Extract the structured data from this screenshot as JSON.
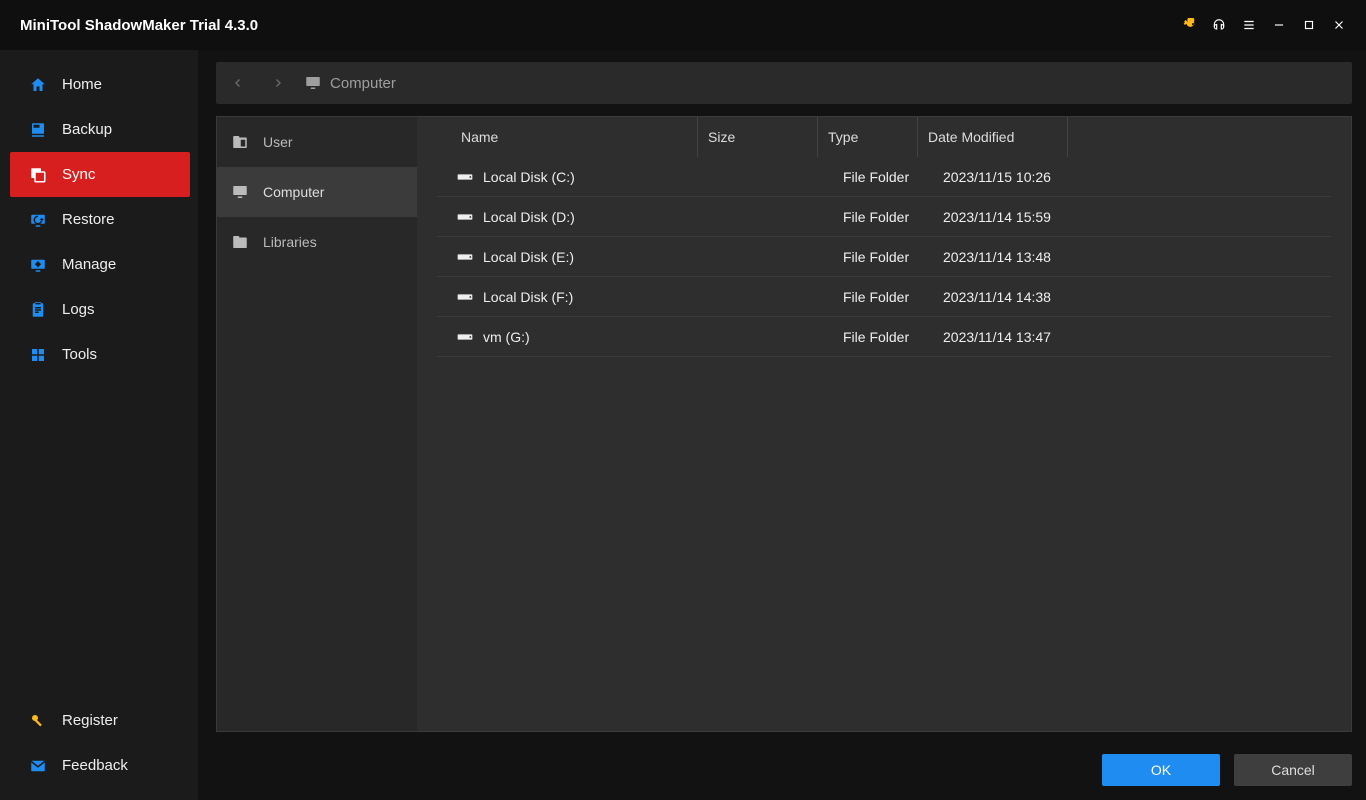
{
  "titlebar": {
    "title": "MiniTool ShadowMaker Trial 4.3.0"
  },
  "sidebar": {
    "items": [
      {
        "name": "home",
        "label": "Home"
      },
      {
        "name": "backup",
        "label": "Backup"
      },
      {
        "name": "sync",
        "label": "Sync"
      },
      {
        "name": "restore",
        "label": "Restore"
      },
      {
        "name": "manage",
        "label": "Manage"
      },
      {
        "name": "logs",
        "label": "Logs"
      },
      {
        "name": "tools",
        "label": "Tools"
      }
    ],
    "bottom": [
      {
        "name": "register",
        "label": "Register"
      },
      {
        "name": "feedback",
        "label": "Feedback"
      }
    ]
  },
  "breadcrumb": {
    "current": "Computer"
  },
  "tree": [
    {
      "name": "user",
      "label": "User"
    },
    {
      "name": "computer",
      "label": "Computer"
    },
    {
      "name": "libraries",
      "label": "Libraries"
    }
  ],
  "columns": {
    "name": "Name",
    "size": "Size",
    "type": "Type",
    "date": "Date Modified"
  },
  "rows": [
    {
      "name": "Local Disk (C:)",
      "size": "",
      "type": "File Folder",
      "date": "2023/11/15 10:26"
    },
    {
      "name": "Local Disk (D:)",
      "size": "",
      "type": "File Folder",
      "date": "2023/11/14 15:59"
    },
    {
      "name": "Local Disk (E:)",
      "size": "",
      "type": "File Folder",
      "date": "2023/11/14 13:48"
    },
    {
      "name": "Local Disk (F:)",
      "size": "",
      "type": "File Folder",
      "date": "2023/11/14 14:38"
    },
    {
      "name": "vm (G:)",
      "size": "",
      "type": "File Folder",
      "date": "2023/11/14 13:47"
    }
  ],
  "buttons": {
    "ok": "OK",
    "cancel": "Cancel"
  }
}
